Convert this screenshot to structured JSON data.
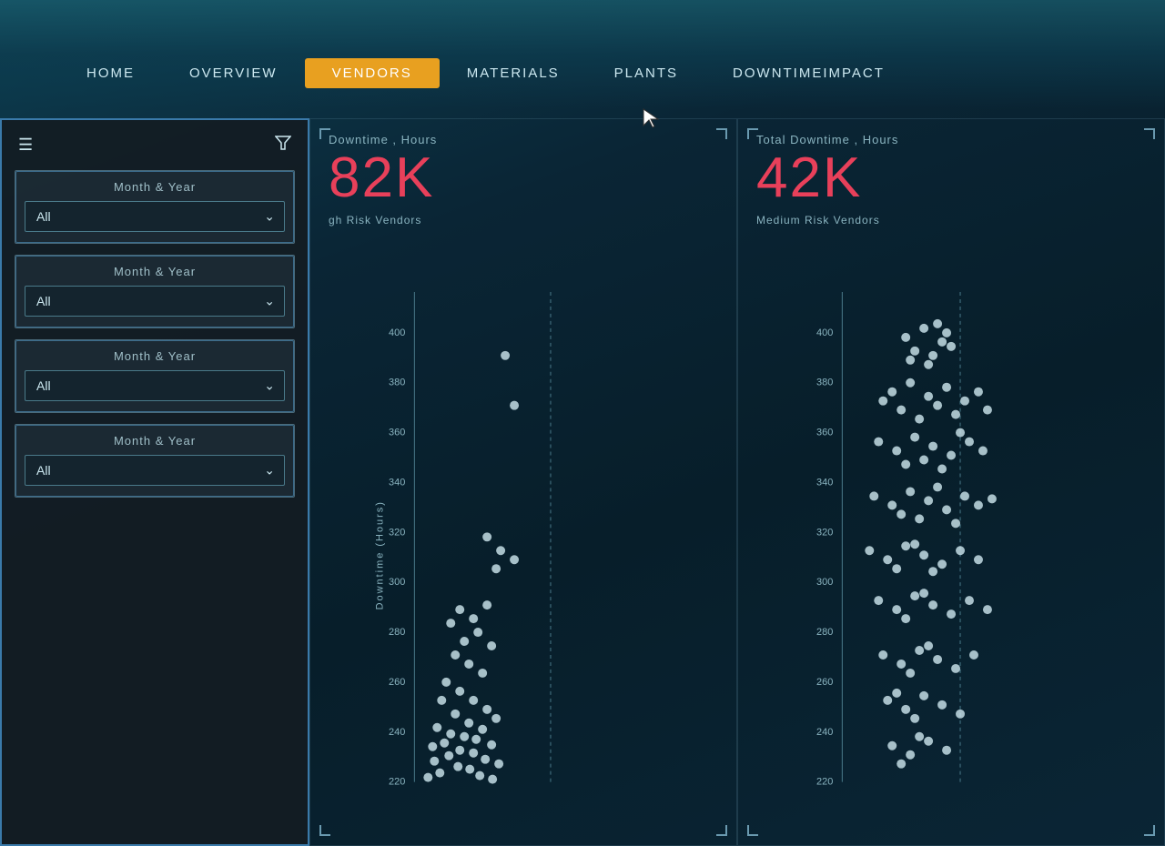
{
  "nav": {
    "items": [
      {
        "id": "home",
        "label": "Home",
        "active": false
      },
      {
        "id": "overview",
        "label": "Overview",
        "active": false
      },
      {
        "id": "vendors",
        "label": "Vendors",
        "active": true
      },
      {
        "id": "materials",
        "label": "Materials",
        "active": false
      },
      {
        "id": "plants",
        "label": "Plants",
        "active": false
      },
      {
        "id": "downtime",
        "label": "DowntimeImpact",
        "active": false
      }
    ]
  },
  "sidebar": {
    "filters": [
      {
        "id": "filter1",
        "label": "Month & Year",
        "value": "All",
        "placeholder": "All"
      },
      {
        "id": "filter2",
        "label": "Month & Year",
        "value": "All",
        "placeholder": "All"
      },
      {
        "id": "filter3",
        "label": "Month & Year",
        "value": "All",
        "placeholder": "All"
      },
      {
        "id": "filter4",
        "label": "Month & Year",
        "value": "All",
        "placeholder": "All"
      }
    ]
  },
  "charts": {
    "left": {
      "subtitle": "Downtime , Hours",
      "value": "82K",
      "tag": "gh Risk Vendors"
    },
    "right": {
      "subtitle": "Total Downtime , Hours",
      "value": "42K",
      "tag": "Medium Risk Vendors"
    }
  },
  "yaxis": {
    "labels": [
      "220",
      "240",
      "260",
      "280",
      "300",
      "320",
      "340",
      "360",
      "380",
      "400"
    ],
    "title": "Downtime (Hours)"
  }
}
